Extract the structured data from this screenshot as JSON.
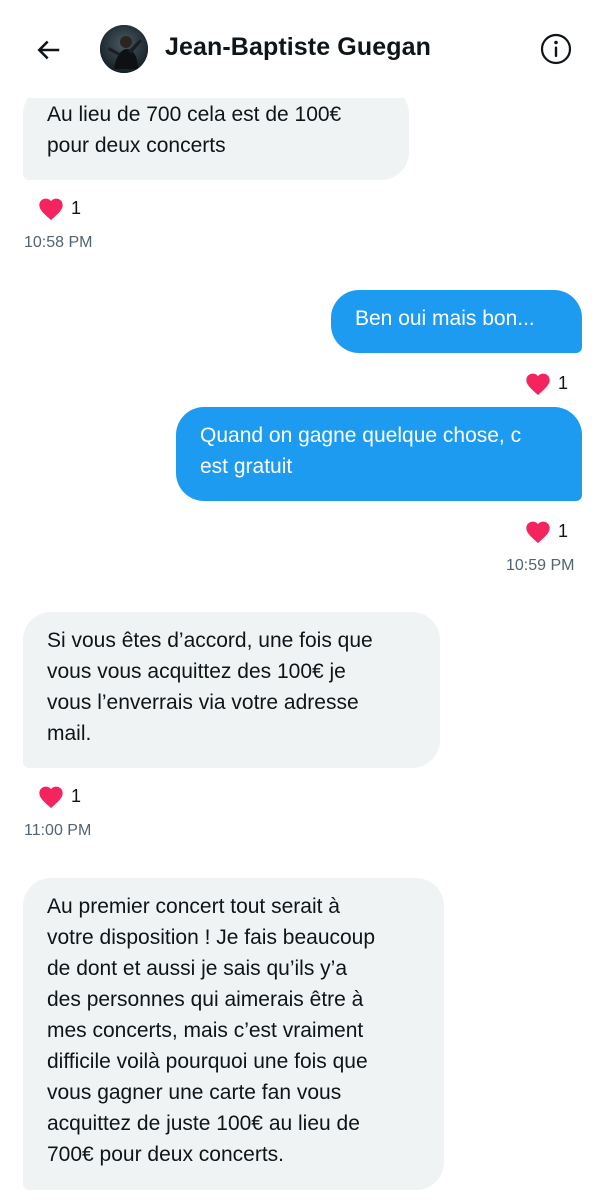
{
  "header": {
    "contact_name": "Jean-Baptiste Guegan",
    "back_icon": "arrow-left-icon",
    "info_icon": "info-icon"
  },
  "messages": [
    {
      "direction": "in",
      "text": "Au lieu de 700 cela est de 100€\npour deux concerts",
      "reaction": "1",
      "time": "10:58 PM"
    },
    {
      "direction": "out",
      "text": "Ben oui mais bon...",
      "reaction": "1"
    },
    {
      "direction": "out",
      "text": "Quand on gagne quelque chose, c\nest gratuit",
      "reaction": "1",
      "time": "10:59 PM"
    },
    {
      "direction": "in",
      "text": "Si vous êtes d’accord, une fois que\nvous vous acquittez des 100€ je\nvous l’enverrais via votre adresse\nmail.",
      "reaction": "1",
      "time": "11:00 PM"
    },
    {
      "direction": "in",
      "text": "Au premier concert tout serait à\nvotre disposition ! Je fais beaucoup\nde dont et aussi je sais qu’ils y’a\ndes personnes qui aimerais être à\nmes concerts, mais c’est vraiment\ndifficile voilà pourquoi une fois que\nvous gagner une carte fan vous\nacquittez de juste 100€ au lieu de\n700€ pour deux concerts."
    }
  ],
  "colors": {
    "accent": "#1d9bf0",
    "incoming_bubble": "#eff3f4",
    "heart": "#f91880",
    "timestamp": "#536471"
  }
}
